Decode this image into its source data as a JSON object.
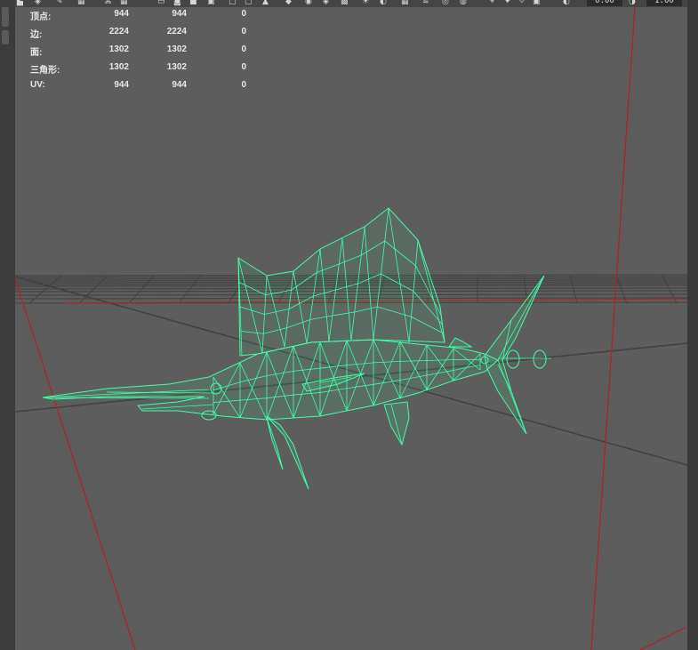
{
  "hud": {
    "rows": [
      {
        "label": "顶点:",
        "v1": "944",
        "v2": "944",
        "v3": "0"
      },
      {
        "label": "边:",
        "v1": "2224",
        "v2": "2224",
        "v3": "0"
      },
      {
        "label": "面:",
        "v1": "1302",
        "v2": "1302",
        "v3": "0"
      },
      {
        "label": "三角形:",
        "v1": "1302",
        "v2": "1302",
        "v3": "0"
      },
      {
        "label": "UV:",
        "v1": "944",
        "v2": "944",
        "v3": "0"
      }
    ]
  },
  "toolbar": {
    "exposure_value": "0.00",
    "gamma_value": "1.00",
    "icons": [
      "select-camera-icon",
      "camera-attributes-icon",
      "bookmark-icon",
      "image-plane-icon",
      "grease-pencil-icon",
      "grid-icon",
      "film-gate-icon",
      "resolution-gate-icon",
      "gate-mask-icon",
      "field-chart-icon",
      "safe-action-icon",
      "safe-title-icon",
      "wireframe-icon",
      "smooth-shade-icon",
      "use-default-material-icon",
      "wireframe-on-shaded-icon",
      "textured-icon",
      "use-all-lights-icon",
      "shadows-icon",
      "screen-space-ao-icon",
      "motion-blur-icon",
      "multisample-aa-icon",
      "depth-of-field-icon",
      "isolate-select-icon",
      "xray-icon",
      "xray-joints-icon",
      "xray-active-components-icon",
      "exposure-icon",
      "gamma-icon"
    ]
  },
  "colors": {
    "viewport_bg": "#5d5d5d",
    "wireframe": "#40ffa8",
    "axis_red": "#b42020",
    "grid": "#3f3f3f",
    "hud_text": "#e8e8e8"
  }
}
